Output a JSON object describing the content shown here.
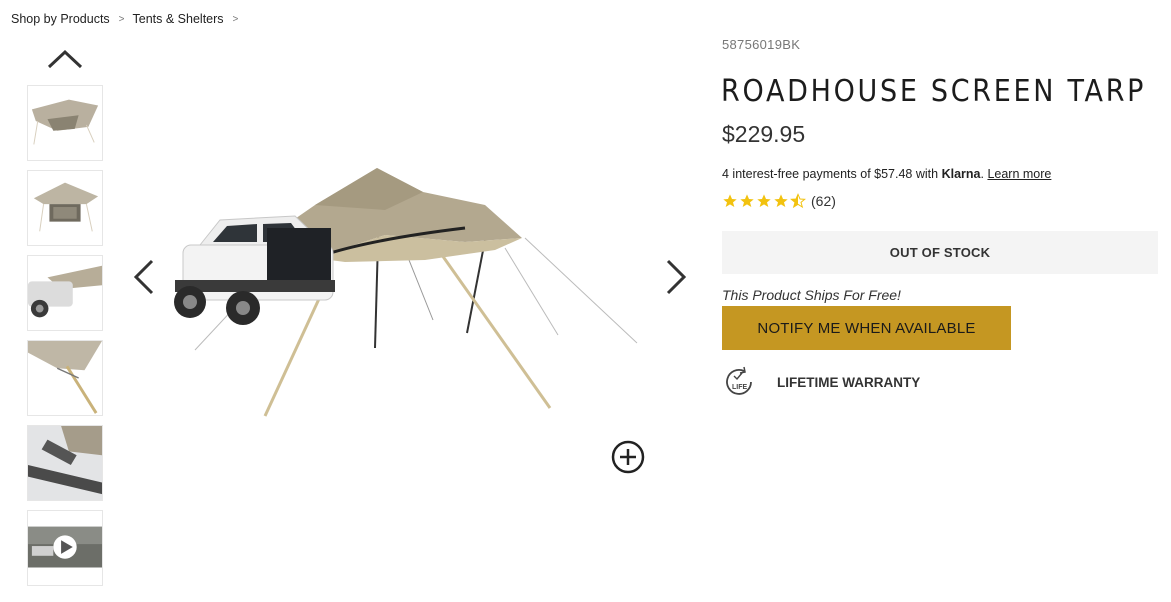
{
  "breadcrumb": {
    "items": [
      "Shop by Products",
      "Tents & Shelters"
    ],
    "separator": ">"
  },
  "gallery": {
    "up_icon": "chevron-up-icon",
    "prev_icon": "chevron-left-icon",
    "next_icon": "chevron-right-icon",
    "zoom_icon": "zoom-plus-icon",
    "thumbnails": [
      "tarp-top-view",
      "tarp-front-view",
      "suv-with-tarp",
      "tarp-pole-closeup",
      "tarp-strap-closeup",
      "video-thumbnail"
    ]
  },
  "product": {
    "sku": "58756019BK",
    "title": "ROADHOUSE SCREEN TARP",
    "price": "$229.95",
    "klarna": {
      "text": "4 interest-free payments of $57.48 with",
      "brand": "Klarna",
      "period": ".",
      "link": "Learn more"
    },
    "rating": {
      "stars": 4.5,
      "count": "(62)",
      "color": "#f2c20f"
    },
    "stock_status": "OUT OF STOCK",
    "shipping_note": "This Product Ships For Free!",
    "notify_button": "NOTIFY ME WHEN AVAILABLE",
    "warranty": {
      "icon": "lifetime-icon",
      "icon_text": "LIFE",
      "label": "LIFETIME WARRANTY"
    },
    "accent_color": "#c59722"
  }
}
